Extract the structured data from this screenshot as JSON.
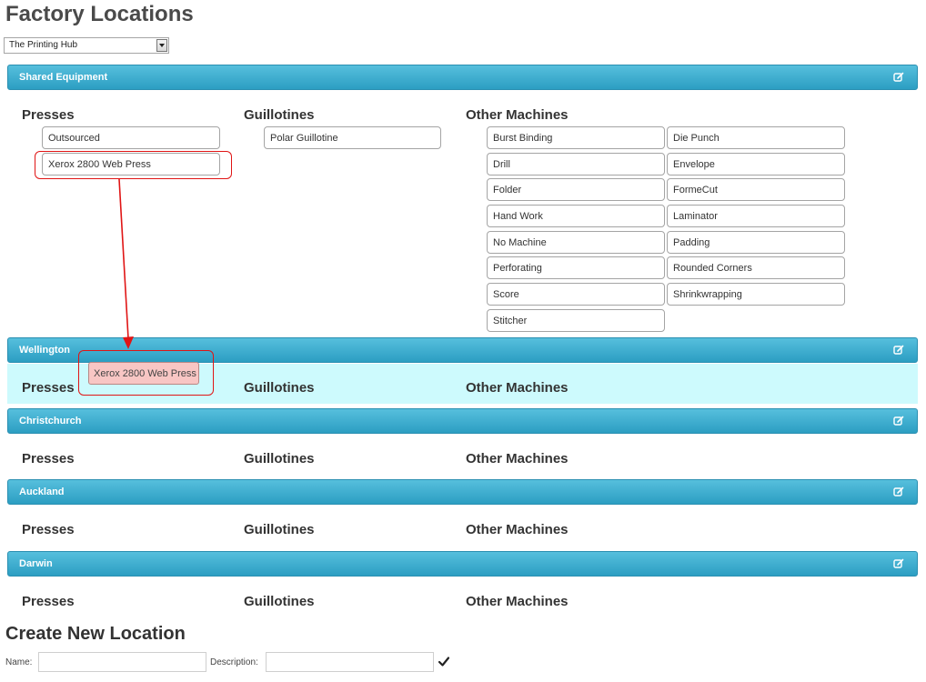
{
  "page": {
    "title": "Factory Locations"
  },
  "site_select": {
    "selected": "The Printing Hub"
  },
  "column_headings": {
    "presses": "Presses",
    "guillotines": "Guillotines",
    "other_machines": "Other Machines"
  },
  "locations": [
    {
      "name": "Shared Equipment"
    },
    {
      "name": "Wellington"
    },
    {
      "name": "Christchurch"
    },
    {
      "name": "Auckland"
    },
    {
      "name": "Darwin"
    }
  ],
  "shared": {
    "presses": [
      "Outsourced",
      "Xerox 2800 Web Press"
    ],
    "guillotines": [
      "Polar Guillotine"
    ],
    "other_left": [
      "Burst Binding",
      "Drill",
      "Folder",
      "Hand Work",
      "No Machine",
      "Perforating",
      "Score",
      "Stitcher"
    ],
    "other_right": [
      "Die Punch",
      "Envelope",
      "FormeCut",
      "Laminator",
      "Padding",
      "Rounded Corners",
      "Shrinkwrapping"
    ]
  },
  "drag": {
    "item_label": "Xerox 2800 Web Press"
  },
  "create": {
    "title": "Create New Location",
    "name_label": "Name:",
    "name_value": "",
    "description_label": "Description:",
    "description_value": ""
  },
  "colors": {
    "panel_header": "#3aaed3",
    "drop_zone": "#cdfafd",
    "dragged_item": "#f8c6c4",
    "annotation": "#e01515"
  },
  "icons": {
    "panel_edit": "edit-icon",
    "submit": "checkmark-icon"
  }
}
